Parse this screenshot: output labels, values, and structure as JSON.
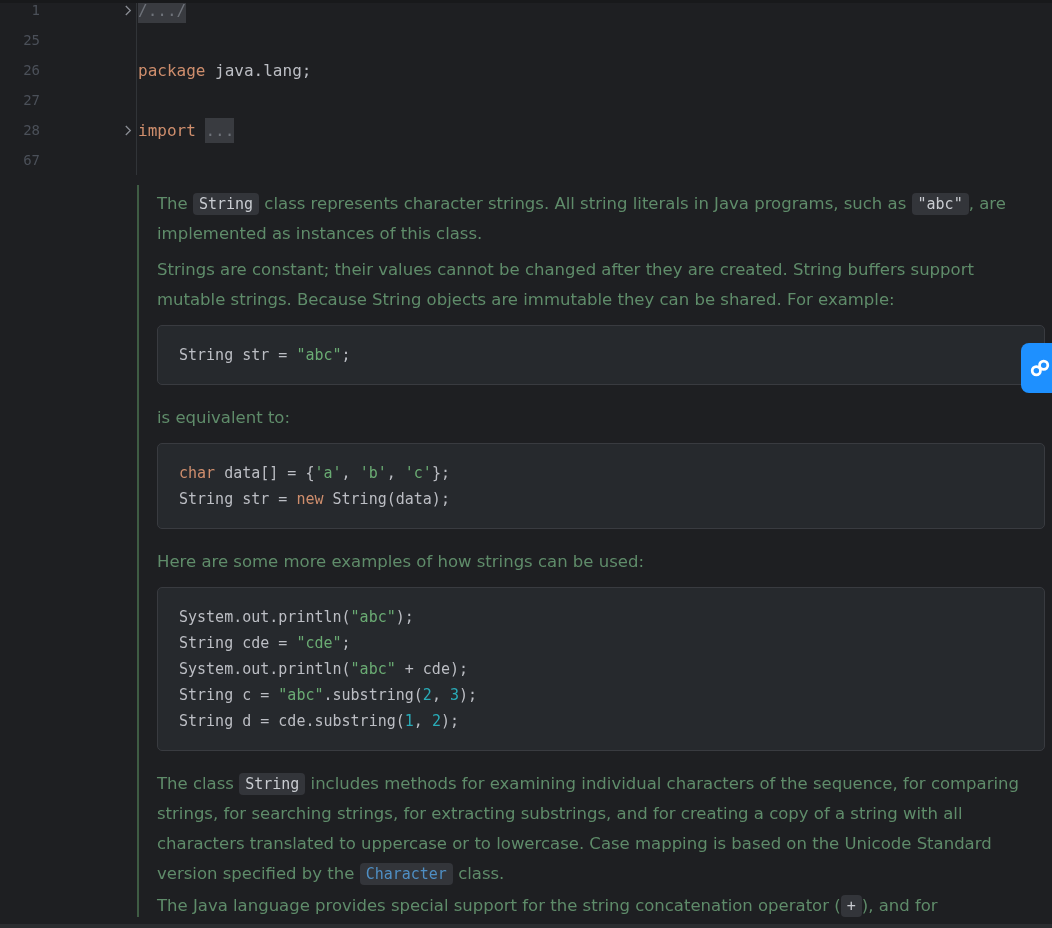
{
  "editor_lines": [
    {
      "number": "1",
      "foldable": true,
      "tokens": [
        {
          "kind": "folded",
          "text": "/.../"
        }
      ]
    },
    {
      "number": "25",
      "foldable": false
    },
    {
      "number": "26",
      "foldable": false,
      "tokens": [
        {
          "kind": "keyword",
          "text": "package"
        },
        {
          "kind": "plain",
          "text": " java.lang;"
        }
      ]
    },
    {
      "number": "27",
      "foldable": false
    },
    {
      "number": "28",
      "foldable": true,
      "tokens": [
        {
          "kind": "keyword",
          "text": "import"
        },
        {
          "kind": "folded",
          "text": "..."
        }
      ]
    },
    {
      "number": "67",
      "foldable": false
    }
  ],
  "doc_comment": [
    {
      "kind": "paragraph",
      "segments": [
        {
          "kind": "text",
          "text": "The "
        },
        {
          "kind": "code",
          "text": "String"
        },
        {
          "kind": "text",
          "text": " class represents character strings. All string literals in Java programs, such as "
        },
        {
          "kind": "code",
          "text": "\"abc\""
        },
        {
          "kind": "text",
          "text": ", are implemented as instances of this class."
        }
      ]
    },
    {
      "kind": "paragraph",
      "segments": [
        {
          "kind": "text",
          "text": "Strings are constant; their values cannot be changed after they are created. String buffers support mutable strings. Because String objects are immutable they can be shared. For example:"
        }
      ]
    },
    {
      "kind": "code_block",
      "lines": [
        {
          "tokens": [
            {
              "kind": "plain",
              "text": "String str = "
            },
            {
              "kind": "string",
              "text": "\"abc\""
            },
            {
              "kind": "plain",
              "text": ";"
            }
          ]
        }
      ]
    },
    {
      "kind": "paragraph",
      "segments": [
        {
          "kind": "text",
          "text": "is equivalent to:"
        }
      ]
    },
    {
      "kind": "code_block",
      "lines": [
        {
          "tokens": [
            {
              "kind": "keyword",
              "text": "char"
            },
            {
              "kind": "plain",
              "text": " data[] = {"
            },
            {
              "kind": "string",
              "text": "'a'"
            },
            {
              "kind": "plain",
              "text": ", "
            },
            {
              "kind": "string",
              "text": "'b'"
            },
            {
              "kind": "plain",
              "text": ", "
            },
            {
              "kind": "string",
              "text": "'c'"
            },
            {
              "kind": "plain",
              "text": "};"
            }
          ]
        },
        {
          "tokens": [
            {
              "kind": "plain",
              "text": "String str = "
            },
            {
              "kind": "keyword",
              "text": "new"
            },
            {
              "kind": "plain",
              "text": " String(data);"
            }
          ]
        }
      ]
    },
    {
      "kind": "paragraph",
      "segments": [
        {
          "kind": "text",
          "text": "Here are some more examples of how strings can be used:"
        }
      ]
    },
    {
      "kind": "code_block",
      "lines": [
        {
          "tokens": [
            {
              "kind": "plain",
              "text": "System.out.println("
            },
            {
              "kind": "string",
              "text": "\"abc\""
            },
            {
              "kind": "plain",
              "text": ");"
            }
          ]
        },
        {
          "tokens": [
            {
              "kind": "plain",
              "text": "String cde = "
            },
            {
              "kind": "string",
              "text": "\"cde\""
            },
            {
              "kind": "plain",
              "text": ";"
            }
          ]
        },
        {
          "tokens": [
            {
              "kind": "plain",
              "text": "System.out.println("
            },
            {
              "kind": "string",
              "text": "\"abc\""
            },
            {
              "kind": "plain",
              "text": " + cde);"
            }
          ]
        },
        {
          "tokens": [
            {
              "kind": "plain",
              "text": "String c = "
            },
            {
              "kind": "string",
              "text": "\"abc\""
            },
            {
              "kind": "plain",
              "text": ".substring("
            },
            {
              "kind": "number",
              "text": "2"
            },
            {
              "kind": "plain",
              "text": ", "
            },
            {
              "kind": "number",
              "text": "3"
            },
            {
              "kind": "plain",
              "text": ");"
            }
          ]
        },
        {
          "tokens": [
            {
              "kind": "plain",
              "text": "String d = cde.substring("
            },
            {
              "kind": "number",
              "text": "1"
            },
            {
              "kind": "plain",
              "text": ", "
            },
            {
              "kind": "number",
              "text": "2"
            },
            {
              "kind": "plain",
              "text": ");"
            }
          ]
        }
      ]
    },
    {
      "kind": "paragraph",
      "segments": [
        {
          "kind": "text",
          "text": "The class "
        },
        {
          "kind": "code",
          "text": "String"
        },
        {
          "kind": "text",
          "text": " includes methods for examining individual characters of the sequence, for comparing strings, for searching strings, for extracting substrings, and for creating a copy of a string with all characters translated to uppercase or to lowercase. Case mapping is based on the Unicode Standard version specified by the "
        },
        {
          "kind": "link_code",
          "text": "Character"
        },
        {
          "kind": "text",
          "text": " class."
        }
      ]
    },
    {
      "kind": "paragraph",
      "segments": [
        {
          "kind": "text",
          "text": "The Java language provides special support for the string concatenation operator ("
        },
        {
          "kind": "code",
          "text": "+"
        },
        {
          "kind": "text",
          "text": "), and for"
        }
      ]
    }
  ]
}
